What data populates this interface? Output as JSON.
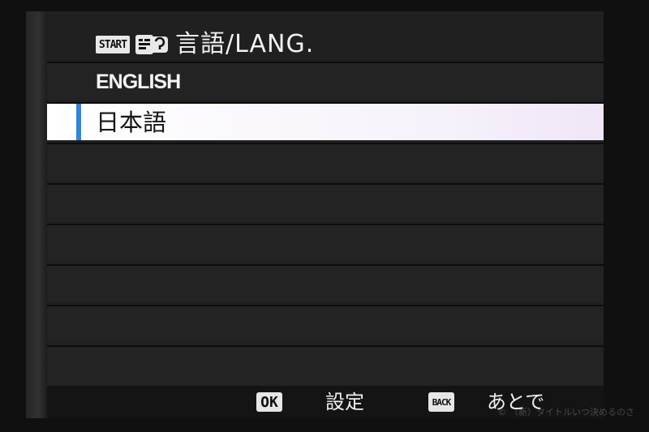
{
  "title": {
    "start_tag": "START",
    "text": "言語/LANG.",
    "lang_icon": "language-speech-icon"
  },
  "languages": [
    {
      "label": "ENGLISH",
      "selected": false
    },
    {
      "label": "日本語",
      "selected": true
    }
  ],
  "empty_rows": 6,
  "footer": {
    "ok_badge": "OK",
    "ok_label": "設定",
    "back_badge": "BACK",
    "back_label": "あとで"
  },
  "watermark": "© （新）タイトルいつ決めるのさ",
  "colors": {
    "selection_marker": "#2d86e0",
    "selected_row_bg": "#ffffff",
    "row_bg": "#232323"
  }
}
